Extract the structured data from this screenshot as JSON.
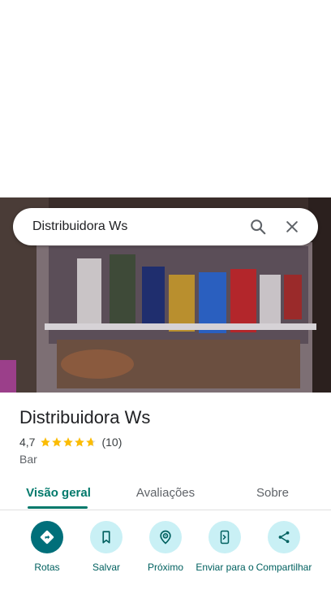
{
  "search": {
    "query": "Distribuidora Ws",
    "search_icon": "search-icon",
    "clear_icon": "close-icon"
  },
  "place": {
    "name": "Distribuidora Ws",
    "rating": "4,7",
    "rating_value": 4.7,
    "review_count": "(10)",
    "category": "Bar"
  },
  "tabs": [
    {
      "label": "Visão geral",
      "active": true
    },
    {
      "label": "Avaliações",
      "active": false
    },
    {
      "label": "Sobre",
      "active": false
    }
  ],
  "actions": [
    {
      "label": "Rotas",
      "icon": "directions-icon"
    },
    {
      "label": "Salvar",
      "icon": "bookmark-icon"
    },
    {
      "label": "Próximo",
      "icon": "nearby-icon"
    },
    {
      "label": "Enviar para o",
      "icon": "send-to-phone-icon"
    },
    {
      "label": "Compartilhar",
      "icon": "share-icon"
    }
  ],
  "colors": {
    "accent": "#00796b",
    "action_bg": "#c9f0f5",
    "primary_action_bg": "#006f7a",
    "star": "#fbbc04"
  }
}
